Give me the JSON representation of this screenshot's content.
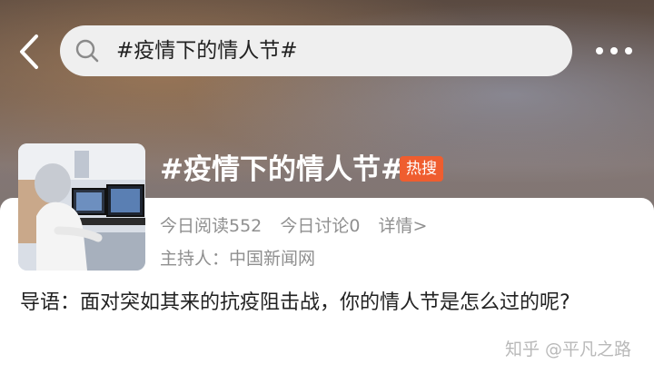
{
  "header": {
    "search_query": "#疫情下的情人节#"
  },
  "topic": {
    "title": "#疫情下的情人节#",
    "badge": "热搜",
    "reads": "今日阅读552",
    "discussions": "今日讨论0",
    "details_link": "详情>",
    "host": "主持人：中国新闻网"
  },
  "intro": {
    "text": "导语：面对突如其来的抗疫阻击战，你的情人节是怎么过的呢?"
  },
  "watermark": "知乎 @平凡之路",
  "icons": {
    "back": "back-chevron-icon",
    "search": "search-icon",
    "more": "more-dots-icon"
  },
  "colors": {
    "badge_bg": "#ef5d2f",
    "meta_text": "#8f8f8f",
    "search_bg": "#efefef"
  }
}
